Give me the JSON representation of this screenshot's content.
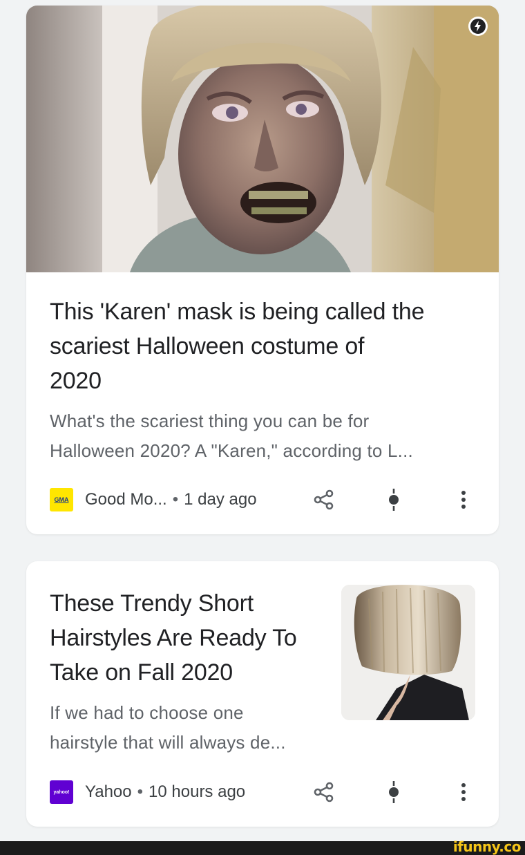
{
  "cards": [
    {
      "title_lines": [
        "This 'Karen' mask is being called the",
        "scariest Halloween costume of",
        "2020"
      ],
      "snippet_lines": [
        "What's the scariest thing you can be for",
        "Halloween 2020? A \"Karen,\" according to L..."
      ],
      "source": {
        "logo_text": "GMA",
        "name": "Good Mo...",
        "time": "1 day ago",
        "logo_color": "#ffe600"
      },
      "image_icon": "amp-lightning-icon"
    },
    {
      "title_lines": [
        "These Trendy Short",
        "Hairstyles Are Ready To",
        "Take on Fall 2020"
      ],
      "snippet_lines": [
        "If we had to choose one",
        "hairstyle that will always de..."
      ],
      "source": {
        "logo_text": "yahoo!",
        "name": "Yahoo",
        "time": "10 hours ago",
        "logo_color": "#6001d2"
      }
    }
  ],
  "separator": "•",
  "action_icons": [
    "share-icon",
    "interest-marker-icon",
    "more-vert-icon"
  ],
  "watermark": "ifunny.co",
  "colors": {
    "background": "#f1f3f4",
    "card": "#ffffff",
    "title": "#202124",
    "snippet": "#5f6368"
  }
}
